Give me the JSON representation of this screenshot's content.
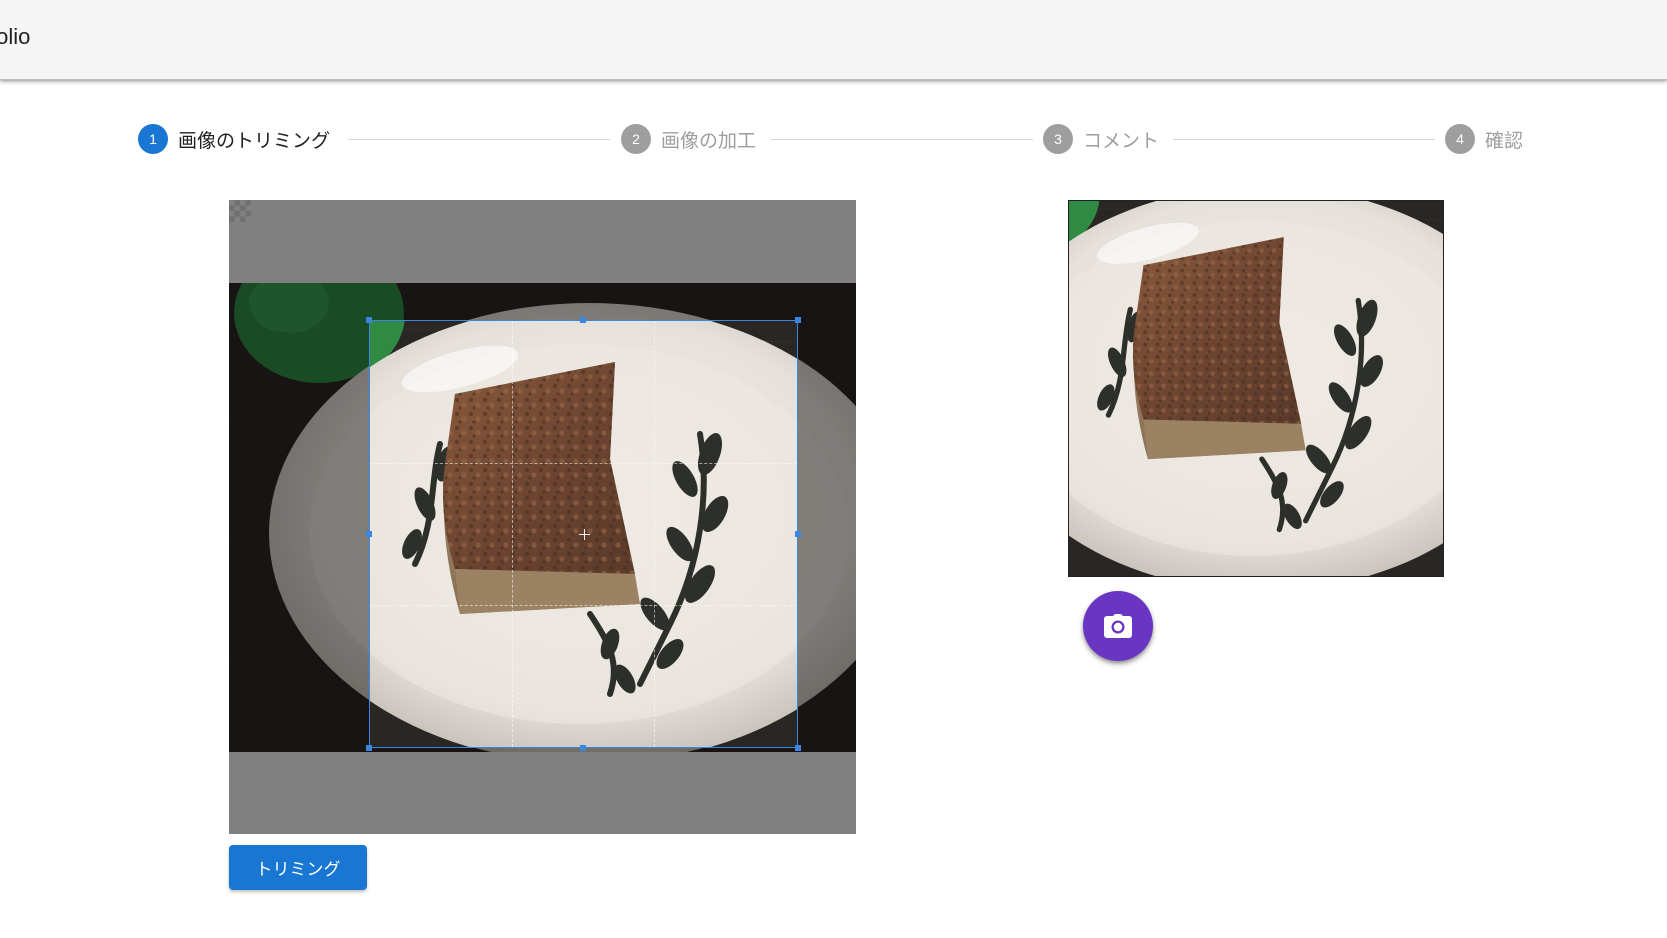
{
  "app": {
    "title": "folio"
  },
  "stepper": {
    "steps": [
      {
        "number": "1",
        "label": "画像のトリミング",
        "state": "active"
      },
      {
        "number": "2",
        "label": "画像の加工",
        "state": "inactive"
      },
      {
        "number": "3",
        "label": "コメント",
        "state": "inactive"
      },
      {
        "number": "4",
        "label": "確認",
        "state": "inactive"
      }
    ]
  },
  "cropper": {
    "image_alt": "cake on plate"
  },
  "actions": {
    "trim_label": "トリミング"
  },
  "preview": {
    "camera_icon": "camera-icon"
  },
  "colors": {
    "primary": "#1976d2",
    "fab": "#6935c2",
    "inactive_step": "#9e9e9e",
    "crop_border": "#3a86e0"
  }
}
